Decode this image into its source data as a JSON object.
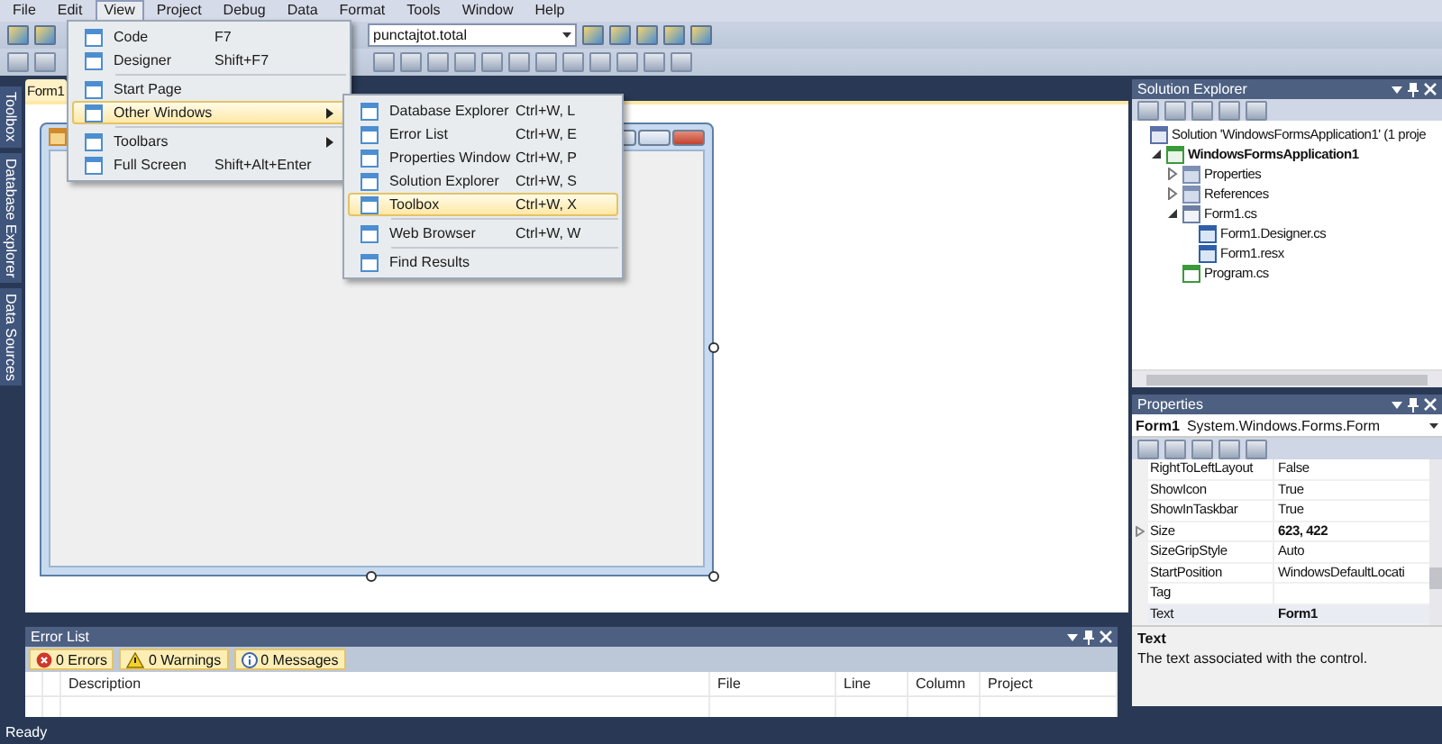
{
  "menubar": {
    "items": [
      {
        "label": "File",
        "selected": false
      },
      {
        "label": "Edit",
        "selected": false
      },
      {
        "label": "View",
        "selected": true
      },
      {
        "label": "Project",
        "selected": false
      },
      {
        "label": "Debug",
        "selected": false
      },
      {
        "label": "Data",
        "selected": false
      },
      {
        "label": "Format",
        "selected": false
      },
      {
        "label": "Tools",
        "selected": false
      },
      {
        "label": "Window",
        "selected": false
      },
      {
        "label": "Help",
        "selected": false
      }
    ]
  },
  "toolbar": {
    "combo_value": "punctajtot.total"
  },
  "view_menu": {
    "items": [
      {
        "kind": "item",
        "label": "Code",
        "shortcut": "F7",
        "selected": false,
        "submenu": false
      },
      {
        "kind": "item",
        "label": "Designer",
        "shortcut": "Shift+F7",
        "selected": false,
        "submenu": false
      },
      {
        "kind": "separator"
      },
      {
        "kind": "item",
        "label": "Start Page",
        "selected": false,
        "submenu": false
      },
      {
        "kind": "item",
        "label": "Other Windows",
        "selected": true,
        "submenu": true
      },
      {
        "kind": "separator"
      },
      {
        "kind": "item",
        "label": "Toolbars",
        "selected": false,
        "submenu": true
      },
      {
        "kind": "item",
        "label": "Full Screen",
        "shortcut": "Shift+Alt+Enter",
        "selected": false,
        "submenu": false
      }
    ]
  },
  "other_windows_menu": {
    "items": [
      {
        "kind": "item",
        "label": "Database Explorer",
        "shortcut": "Ctrl+W, L",
        "selected": false
      },
      {
        "kind": "item",
        "label": "Error List",
        "shortcut": "Ctrl+W, E",
        "selected": false
      },
      {
        "kind": "item",
        "label": "Properties Window",
        "shortcut": "Ctrl+W, P",
        "selected": false
      },
      {
        "kind": "item",
        "label": "Solution Explorer",
        "shortcut": "Ctrl+W, S",
        "selected": false
      },
      {
        "kind": "item",
        "label": "Toolbox",
        "shortcut": "Ctrl+W, X",
        "selected": true
      },
      {
        "kind": "separator"
      },
      {
        "kind": "item",
        "label": "Web Browser",
        "shortcut": "Ctrl+W, W",
        "selected": false
      },
      {
        "kind": "separator"
      },
      {
        "kind": "item",
        "label": "Find Results",
        "selected": false
      }
    ]
  },
  "side_tabs": [
    "Toolbox",
    "Database Explorer",
    "Data Sources"
  ],
  "document_tab": {
    "label": "Form1"
  },
  "solution_explorer": {
    "title": "Solution Explorer",
    "tree": [
      {
        "kind": "solution",
        "label": "Solution 'WindowsFormsApplication1' (1 proje",
        "children": [
          {
            "kind": "project",
            "label": "WindowsFormsApplication1",
            "bold": true,
            "expanded": true,
            "children": [
              {
                "kind": "folder",
                "label": "Properties",
                "expanded": false
              },
              {
                "kind": "folder",
                "label": "References",
                "expanded": false
              },
              {
                "kind": "form",
                "label": "Form1.cs",
                "expanded": true,
                "children": [
                  {
                    "kind": "file",
                    "label": "Form1.Designer.cs"
                  },
                  {
                    "kind": "file",
                    "label": "Form1.resx"
                  }
                ]
              },
              {
                "kind": "code",
                "label": "Program.cs"
              }
            ]
          }
        ]
      }
    ]
  },
  "properties": {
    "title": "Properties",
    "object_name": "Form1",
    "object_type": "System.Windows.Forms.Form",
    "rows": [
      {
        "name": "RightToLeftLayout",
        "value": "False",
        "modified": false,
        "expandable": false,
        "selected": false
      },
      {
        "name": "ShowIcon",
        "value": "True",
        "modified": false,
        "expandable": false,
        "selected": false
      },
      {
        "name": "ShowInTaskbar",
        "value": "True",
        "modified": false,
        "expandable": false,
        "selected": false
      },
      {
        "name": "Size",
        "value": "623, 422",
        "modified": true,
        "expandable": true,
        "selected": false
      },
      {
        "name": "SizeGripStyle",
        "value": "Auto",
        "modified": false,
        "expandable": false,
        "selected": false
      },
      {
        "name": "StartPosition",
        "value": "WindowsDefaultLocati",
        "modified": false,
        "expandable": false,
        "selected": false
      },
      {
        "name": "Tag",
        "expandable": false,
        "selected": false
      },
      {
        "name": "Text",
        "value": "Form1",
        "modified": true,
        "expandable": false,
        "selected": true
      }
    ],
    "description": {
      "title": "Text",
      "body": "The text associated with the control."
    }
  },
  "error_list": {
    "title": "Error List",
    "filters": [
      {
        "kind": "error",
        "label": "0 Errors",
        "selected": true
      },
      {
        "kind": "warning",
        "label": "0 Warnings",
        "selected": true
      },
      {
        "kind": "info",
        "label": "0 Messages",
        "selected": true
      }
    ],
    "columns": [
      "Description",
      "File",
      "Line",
      "Column",
      "Project"
    ]
  },
  "status_bar": {
    "text": "Ready"
  }
}
